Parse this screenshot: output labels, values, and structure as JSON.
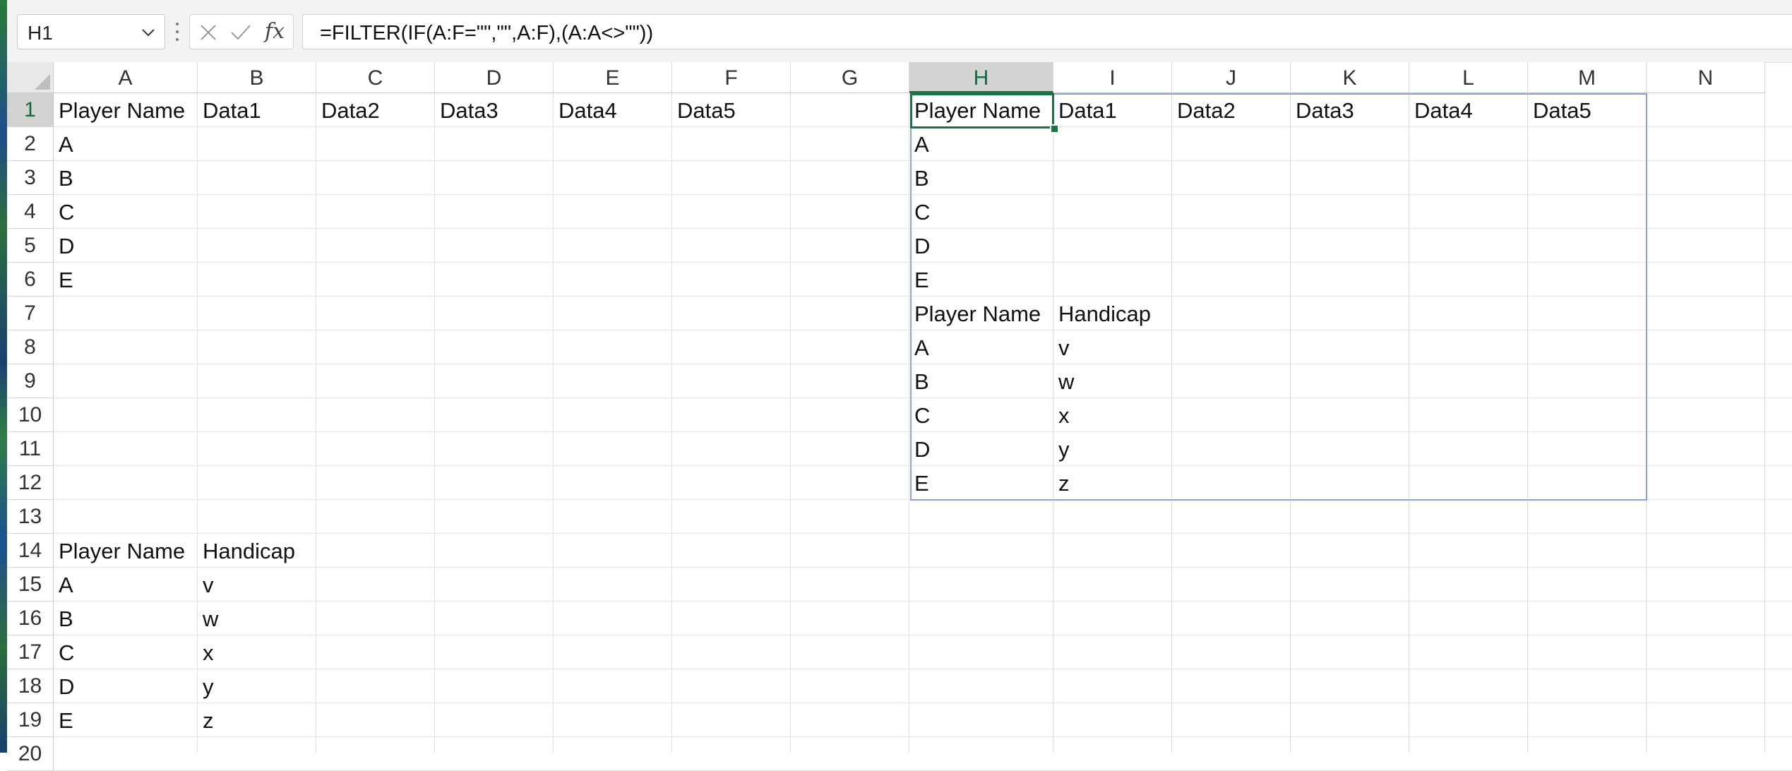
{
  "name_box": {
    "value": "H1"
  },
  "formula_bar": {
    "formula": "=FILTER(IF(A:F=\"\",\"\",A:F),(A:A<>\"\"))",
    "fx_label": "fx"
  },
  "columns": [
    "A",
    "B",
    "C",
    "D",
    "E",
    "F",
    "G",
    "H",
    "I",
    "J",
    "K",
    "L",
    "M",
    "N"
  ],
  "active_column": "H",
  "rows": [
    "1",
    "2",
    "3",
    "4",
    "5",
    "6",
    "7",
    "8",
    "9",
    "10",
    "11",
    "12",
    "13",
    "14",
    "15",
    "16",
    "17",
    "18",
    "19",
    "20"
  ],
  "active_row": "1",
  "cells": {
    "A1": "Player Name",
    "B1": "Data1",
    "C1": "Data2",
    "D1": "Data3",
    "E1": "Data4",
    "F1": "Data5",
    "A2": "A",
    "A3": "B",
    "A4": "C",
    "A5": "D",
    "A6": "E",
    "A14": "Player Name",
    "B14": "Handicap",
    "A15": "A",
    "B15": "v",
    "A16": "B",
    "B16": "w",
    "A17": "C",
    "B17": "x",
    "A18": "D",
    "B18": "y",
    "A19": "E",
    "B19": "z",
    "H1": "Player Name",
    "I1": "Data1",
    "J1": "Data2",
    "K1": "Data3",
    "L1": "Data4",
    "M1": "Data5",
    "H2": "A",
    "H3": "B",
    "H4": "C",
    "H5": "D",
    "H6": "E",
    "H7": "Player Name",
    "I7": "Handicap",
    "H8": "A",
    "I8": "v",
    "H9": "B",
    "I9": "w",
    "H10": "C",
    "I10": "x",
    "H11": "D",
    "I11": "y",
    "H12": "E",
    "I12": "z"
  },
  "colors": {
    "accent": "#1e7145",
    "spill_border": "#8aa4d6"
  },
  "icons": {
    "cancel": "x-icon",
    "enter": "check-icon",
    "dropdown": "chevron-down-icon"
  }
}
